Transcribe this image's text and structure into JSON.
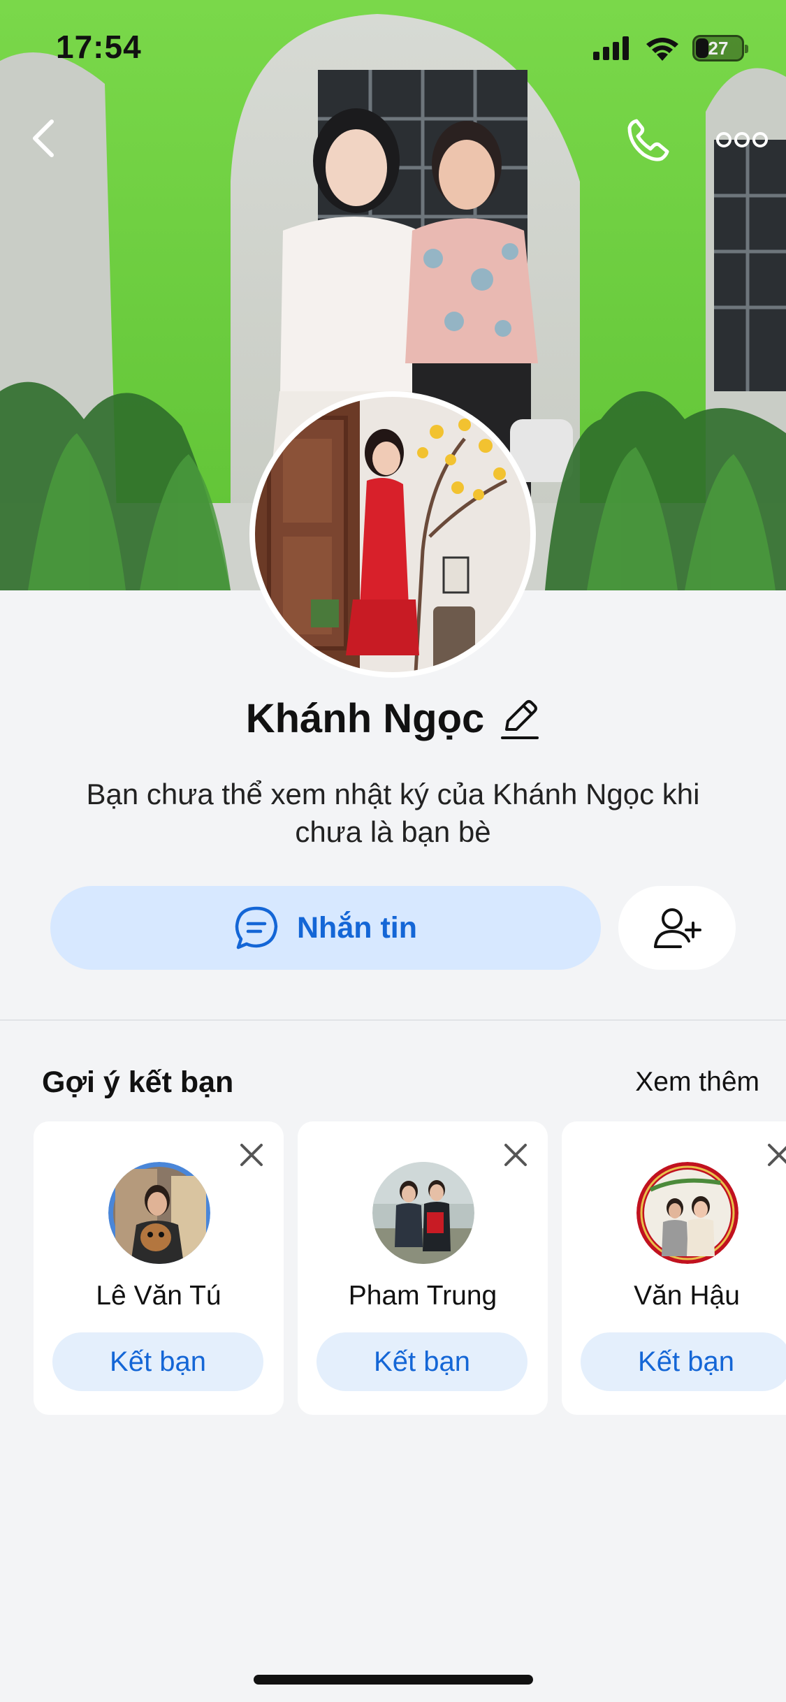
{
  "status_bar": {
    "time": "17:54",
    "battery": "27"
  },
  "cover": {
    "back_icon": "chevron-left-icon",
    "call_icon": "phone-icon",
    "more_icon": "more-dots-icon"
  },
  "profile": {
    "name": "Khánh Ngọc",
    "edit_icon": "pencil-icon",
    "bio": "Bạn chưa thể xem nhật ký của Khánh Ngọc khi chưa là bạn bè",
    "message_label": "Nhắn tin",
    "message_icon": "chat-bubble-icon",
    "add_friend_icon": "add-user-icon"
  },
  "suggestions": {
    "title": "Gợi ý kết bạn",
    "see_more": "Xem thêm",
    "items": [
      {
        "name": "Lê Văn Tú",
        "button": "Kết bạn"
      },
      {
        "name": "Pham Trung",
        "button": "Kết bạn"
      },
      {
        "name": "Văn Hậu",
        "button": "Kết bạn"
      }
    ]
  },
  "colors": {
    "accent": "#1466d6",
    "accent_bg": "#d7e8ff",
    "page_bg": "#f3f4f6"
  }
}
